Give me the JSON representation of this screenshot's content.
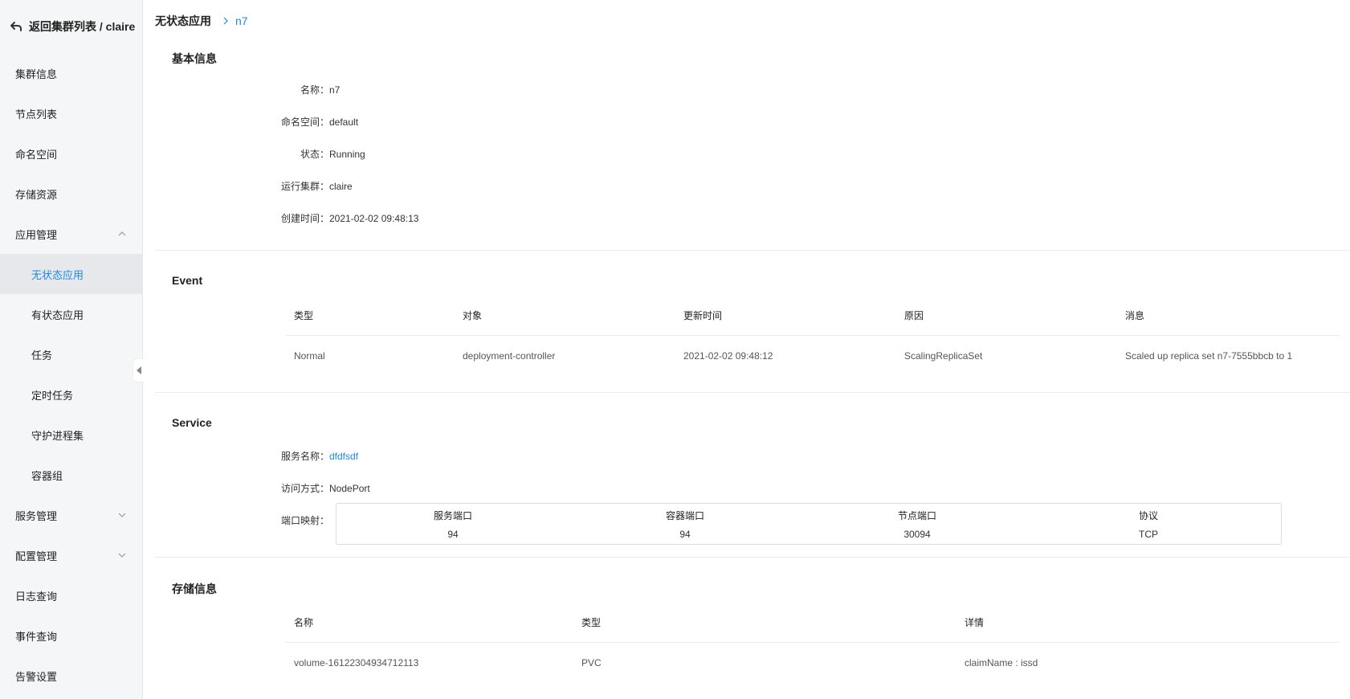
{
  "sidebar": {
    "back_label": "返回集群列表 / claire",
    "items": [
      {
        "label": "集群信息"
      },
      {
        "label": "节点列表"
      },
      {
        "label": "命名空间"
      },
      {
        "label": "存储资源"
      },
      {
        "label": "应用管理"
      },
      {
        "label": "无状态应用"
      },
      {
        "label": "有状态应用"
      },
      {
        "label": "任务"
      },
      {
        "label": "定时任务"
      },
      {
        "label": "守护进程集"
      },
      {
        "label": "容器组"
      },
      {
        "label": "服务管理"
      },
      {
        "label": "配置管理"
      },
      {
        "label": "日志查询"
      },
      {
        "label": "事件查询"
      },
      {
        "label": "告警设置"
      }
    ]
  },
  "breadcrumb": {
    "root": "无状态应用",
    "current": "n7"
  },
  "basic": {
    "title": "基本信息",
    "rows": [
      {
        "key": "名称：",
        "value": "n7"
      },
      {
        "key": "命名空间：",
        "value": "default"
      },
      {
        "key": "状态：",
        "value": "Running"
      },
      {
        "key": "运行集群：",
        "value": "claire"
      },
      {
        "key": "创建时间：",
        "value": "2021-02-02 09:48:13"
      }
    ]
  },
  "event": {
    "title": "Event",
    "columns": [
      "类型",
      "对象",
      "更新时间",
      "原因",
      "消息"
    ],
    "rows": [
      [
        "Normal",
        "deployment-controller",
        "2021-02-02 09:48:12",
        "ScalingReplicaSet",
        "Scaled up replica set n7-7555bbcb to 1"
      ]
    ]
  },
  "service": {
    "title": "Service",
    "name_key": "服务名称：",
    "name_value": "dfdfsdf",
    "access_key": "访问方式：",
    "access_value": "NodePort",
    "ports_key": "端口映射：",
    "port_columns": [
      "服务端口",
      "容器端口",
      "节点端口",
      "协议"
    ],
    "port_values": [
      "94",
      "94",
      "30094",
      "TCP"
    ]
  },
  "storage": {
    "title": "存储信息",
    "columns": [
      "名称",
      "类型",
      "详情"
    ],
    "rows": [
      [
        "volume-16122304934712113",
        "PVC",
        "claimName : issd"
      ]
    ]
  },
  "colors": {
    "accent": "#1e88e5",
    "sidebar_bg": "#f5f6f7",
    "active_bg": "#e6e8ec"
  }
}
